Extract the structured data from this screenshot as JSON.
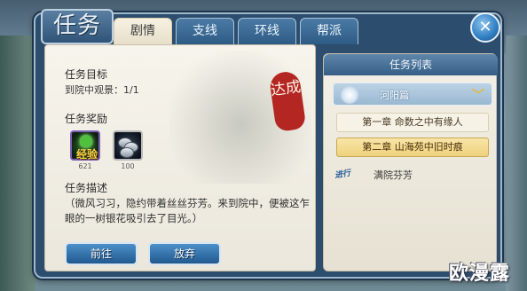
{
  "window": {
    "title": "任务",
    "tabs": [
      "剧情",
      "支线",
      "环线",
      "帮派"
    ],
    "active_tab": "剧情",
    "close_symbol": "✕"
  },
  "detail": {
    "seal_text": "达成",
    "goal_title": "任务目标",
    "goal_text": "到院中观景：1/1",
    "reward_title": "任务奖励",
    "rewards": [
      {
        "icon": "exp-gem-icon",
        "label": "经验",
        "amount": "621"
      },
      {
        "icon": "coin-stack-icon",
        "label": "",
        "amount": "100"
      }
    ],
    "desc_title": "任务描述",
    "desc_text": "（微风习习，隐约带着丝丝芬芳。来到院中，便被这乍眼的一树银花吸引去了目光。）",
    "buttons": {
      "go": "前往",
      "abandon": "放弃"
    }
  },
  "quest_list": {
    "title": "任务列表",
    "group": {
      "label": "河阳篇",
      "icon": "flower-icon",
      "expanded": true
    },
    "chapters": [
      {
        "label": "第一章 命数之中有缘人",
        "selected": false
      },
      {
        "label": "第二章 山海苑中旧时痕",
        "selected": true
      }
    ],
    "active_quest": {
      "status": "进行",
      "label": "满院芬芳"
    }
  },
  "watermark": "欧漫露",
  "colors": {
    "frame": "#2c4d6e",
    "seal": "#b32622",
    "selected_chapter": "#eed27c",
    "button": "#21598f"
  }
}
